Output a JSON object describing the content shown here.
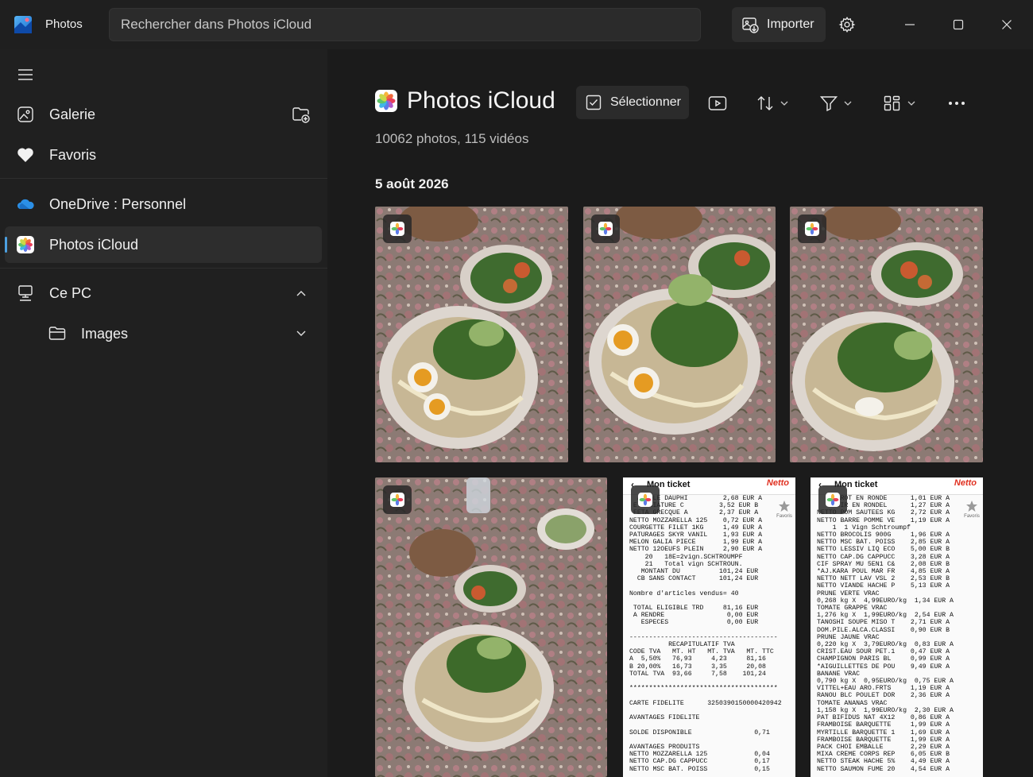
{
  "app": {
    "title": "Photos"
  },
  "search": {
    "placeholder": "Rechercher dans Photos iCloud"
  },
  "titlebar": {
    "import_label": "Importer"
  },
  "sidebar": {
    "items": [
      {
        "label": "Galerie"
      },
      {
        "label": "Favoris"
      },
      {
        "label": "OneDrive : Personnel"
      },
      {
        "label": "Photos iCloud"
      },
      {
        "label": "Ce PC"
      },
      {
        "label": "Images"
      }
    ]
  },
  "main": {
    "title": "Photos iCloud",
    "select_label": "Sélectionner",
    "subtitle": "10062 photos, 115 vidéos",
    "date_heading": "5 août 2026"
  },
  "receipts": [
    {
      "header": "Mon ticket",
      "store": "Netto",
      "fav_label": "Favoris",
      "text": "  AVIOLE DAUPHI         2,68 EUR A\n E.MINIATURE C         3,52 EUR B\n FETA GRECQUE A        2,37 EUR A\nNETTO MOZZARELLA 125    0,72 EUR A\nCOURGETTE FILET 1KG     1,49 EUR A\nPATURAGES SKYR VANIL    1,93 EUR A\nMELON GALIA PIECE       1,99 EUR A\nNETTO 12OEUFS PLEIN     2,90 EUR A\n    20   18E=2vign.SCHTROUMPF\n    21   Total vign SCHTROUN.\n   MONTANT DU          101,24 EUR\n  CB SANS CONTACT      101,24 EUR\n\nNombre d'articles vendus= 40\n\n TOTAL ELIGIBLE TRD     81,16 EUR\n A RENDRE                0,00 EUR\n   ESPECES               0,00 EUR\n\n--------------------------------------\n          RECAPITULATIF TVA\nCODE TVA   MT. HT   MT. TVA   MT. TTC\nA  5,50%   76,93     4,23     81,16\nB 20,00%   16,73     3,35     20,08\nTOTAL TVA  93,66     7,58    101,24\n\n**************************************\n\nCARTE FIDELITE      3250390150000420942\n\nAVANTAGES FIDELITE\n\nSOLDE DISPONIBLE                0,71\n\nAVANTAGES PRODUITS\nNETTO MOZZARELLA 125            0,04\nNETTO CAP.DG CAPPUCC            0,17\nNETTO MSC BAT. POISS            0,15"
    },
    {
      "header": "Mon ticket",
      "store": "Netto",
      "fav_label": "Favoris",
      "text": "    CAROT EN RONDE      1,01 EUR A\n    POIR EN RONDEL      1,27 EUR A\nNETTO POM SAUTEES KG    2,72 EUR A\nNETTO BARRE POMME VE    1,19 EUR A\n    1  1 Vign Schtroumpf\nNETTO BROCOLIS 900G     1,96 EUR A\nNETTO MSC BAT. POISS    2,85 EUR A\nNETTO LESSIV LIQ ECO    5,00 EUR B\nNETTO CAP.DG CAPPUCC    3,28 EUR A\nCIF SPRAY MU 5EN1 C&    2,08 EUR B\n*AJ.KARA POUL MAR FR    4,85 EUR A\nNETTO NETT LAV VSL 2    2,53 EUR B\nNETTO VIANDE HACHE P    5,13 EUR A\nPRUNE VERTE VRAC\n0,268 kg X  4,99EURO/kg  1,34 EUR A\nTOMATE GRAPPE VRAC\n1,276 kg X  1,99EURO/kg  2,54 EUR A\nTANOSHI SOUPE MISO T    2,71 EUR A\nDOM.PILE.ALCA.CLASSI    0,90 EUR B\nPRUNE JAUNE VRAC\n0,220 kg X  3,79EURO/kg  0,83 EUR A\nCRIST.EAU SOUR PET.1    0,47 EUR A\nCHAMPIGNON PARIS BL     0,99 EUR A\n*AIGUILLETTES DE POU    9,49 EUR A\nBANANE VRAC\n0,790 kg X  0,95EURO/kg  0,75 EUR A\nVITTEL+EAU ARO.FRTS     1,19 EUR A\nRANOU BLC POULET DOR    2,36 EUR A\nTOMATE ANANAS VRAC\n1,158 kg X  1,99EURO/kg  2,30 EUR A\nPAT BIFIDUS NAT 4X12    0,86 EUR A\nFRAMBOISE BARQUETTE     1,99 EUR A\nMYRTILLE BARQUETTE 1    1,69 EUR A\nFRAMBOISE BARQUETTE     1,99 EUR A\nPACK CHOI EMBALLE       2,29 EUR A\nMIXA CREME CORPS REP    6,05 EUR B\nNETTO STEAK HACHE 5%    4,49 EUR A\nNETTO SAUMON FUME 20    4,54 EUR A"
    }
  ],
  "colors": {
    "accent": "#4ca0e0",
    "background": "#1b1b1b",
    "sidebar": "#202020"
  }
}
